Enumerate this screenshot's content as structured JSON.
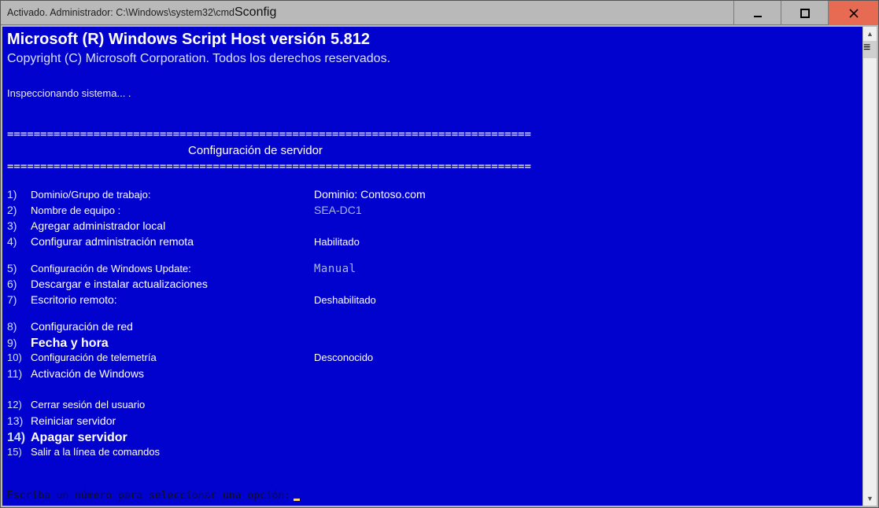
{
  "titlebar": {
    "prefix": "Activado. Administrador: C:\\Windows\\system32\\cmd",
    "suffix": "Sconfig"
  },
  "header": {
    "line1": "Microsoft (R) Windows Script Host versión 5.812",
    "line2": "Copyright (C) Microsoft Corporation. Todos los derechos reservados.",
    "inspect": "Inspeccionando sistema...   ."
  },
  "separator": "===============================================================================",
  "section_title": "Configuración de servidor",
  "menu": [
    {
      "num": "1)",
      "label": "Dominio/Grupo de trabajo:",
      "value": "Dominio: Contoso.com"
    },
    {
      "num": "2)",
      "label": "Nombre de equipo    :",
      "value": "SEA-DC1"
    },
    {
      "num": "3)",
      "label": "Agregar administrador local",
      "value": ""
    },
    {
      "num": "4)",
      "label": "Configurar administración remota",
      "value": "Habilitado"
    }
  ],
  "menu2": [
    {
      "num": "5)",
      "label": "Configuración de Windows Update:",
      "value": "Manual"
    },
    {
      "num": "6)",
      "label": "Descargar e instalar actualizaciones",
      "value": ""
    },
    {
      "num": "7)",
      "label": "Escritorio remoto:",
      "value": "Deshabilitado"
    }
  ],
  "menu3": [
    {
      "num": "8)",
      "label": "Configuración de red",
      "value": ""
    },
    {
      "num": "9)",
      "label": "Fecha y hora",
      "value": ""
    },
    {
      "num": "10)",
      "label": "Configuración de telemetría",
      "value": "Desconocido"
    },
    {
      "num": "11)",
      "label": "Activación de Windows",
      "value": ""
    }
  ],
  "menu4": [
    {
      "num": "12)",
      "label": "Cerrar sesión del usuario",
      "value": ""
    },
    {
      "num": "13)",
      "label": "Reiniciar servidor",
      "value": ""
    },
    {
      "num": "14)",
      "label": "Apagar servidor",
      "value": ""
    },
    {
      "num": "15)",
      "label": "Salir a la línea de comandos",
      "value": ""
    }
  ],
  "prompt": "Escriba un número para seleccionar una opción:"
}
